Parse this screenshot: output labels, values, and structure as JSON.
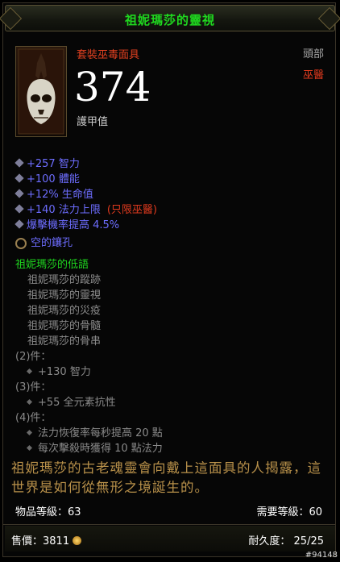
{
  "title": "祖妮瑪莎的靈視",
  "item_type": "套裝巫毒面具",
  "slot": "頭部",
  "class": "巫醫",
  "armor_value": "374",
  "armor_label": "護甲值",
  "stats": [
    {
      "text": "+257 智力"
    },
    {
      "text": "+100 體能"
    },
    {
      "text": "+12% 生命值"
    },
    {
      "text": "+140 法力上限",
      "note": "(只限巫醫)"
    },
    {
      "text": "爆擊機率提高 4.5%"
    }
  ],
  "socket_label": "空的鑲孔",
  "set_name": "祖妮瑪莎的低語",
  "set_members": [
    "祖妮瑪莎的蹤跡",
    "祖妮瑪莎的靈視",
    "祖妮瑪莎的災疫",
    "祖妮瑪莎的骨髓",
    "祖妮瑪莎的骨串"
  ],
  "set_bonuses": [
    {
      "pieces": "(2)件：",
      "bonuses": [
        "+130 智力"
      ]
    },
    {
      "pieces": "(3)件：",
      "bonuses": [
        "+55 全元素抗性"
      ]
    },
    {
      "pieces": "(4)件：",
      "bonuses": [
        "法力恢復率每秒提高 20 點",
        "每次擊殺時獲得 10 點法力"
      ]
    }
  ],
  "flavor_text": "祖妮瑪莎的古老魂靈會向戴上這面具的人揭露，這世界是如何從無形之境誕生的。",
  "item_level": "物品等級：63",
  "required_level": "需要等級：60",
  "sell_price": "售價：3811",
  "durability": "耐久度：  25/25",
  "image_tag": "#94148",
  "colors": {
    "set_green": "#1fd71f",
    "magic_blue": "#6d6dff",
    "class_red": "#e03a1e",
    "flavor_gold": "#b9914a"
  }
}
